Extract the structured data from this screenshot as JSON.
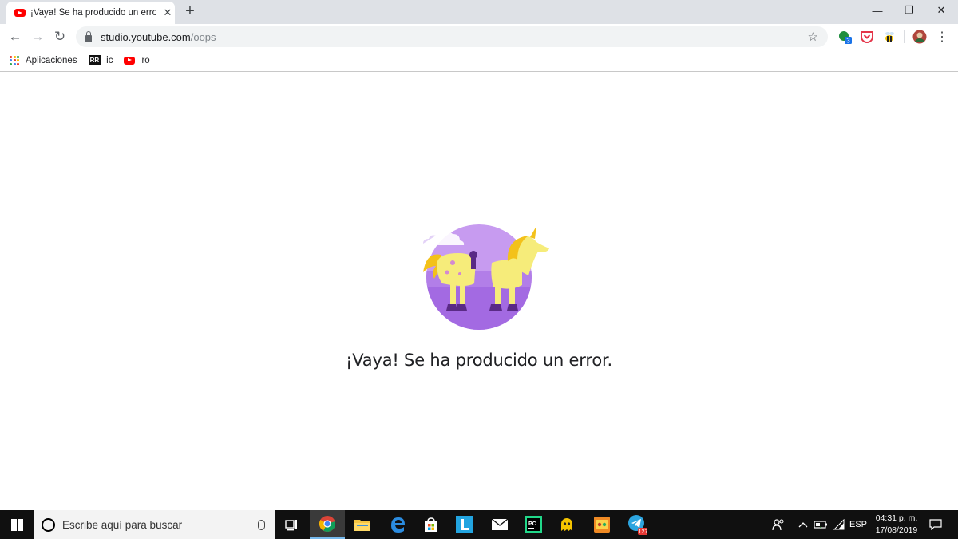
{
  "browser": {
    "tab": {
      "title": "¡Vaya! Se ha producido un error.",
      "close": "✕"
    },
    "new_tab": "+",
    "window_controls": {
      "minimize": "—",
      "restore": "❐",
      "close": "✕"
    },
    "nav": {
      "back": "←",
      "forward": "→",
      "reload": "↻"
    },
    "address": {
      "host": "studio.youtube.com",
      "path": "/oops"
    },
    "star": "☆",
    "extension_badge": "3",
    "menu": "⋮"
  },
  "bookmarks": {
    "apps_label": "Aplicaciones",
    "items": [
      {
        "icon": "rr-icon",
        "badge": "RR",
        "label": "ic"
      },
      {
        "icon": "youtube-icon",
        "label": "ro"
      }
    ]
  },
  "page": {
    "error_message": "¡Vaya! Se ha producido un error."
  },
  "taskbar": {
    "search_placeholder": "Escribe aquí para buscar",
    "telegram_badge": "127",
    "tray": {
      "language": "ESP"
    },
    "clock": {
      "time": "04:31 p. m.",
      "date": "17/08/2019"
    }
  },
  "colors": {
    "tab_strip": "#dee1e6",
    "youtube_red": "#ff0000",
    "illustration_purple": "#b57ee8",
    "illustration_yellow": "#f6ec7a",
    "taskbar": "#101010"
  }
}
